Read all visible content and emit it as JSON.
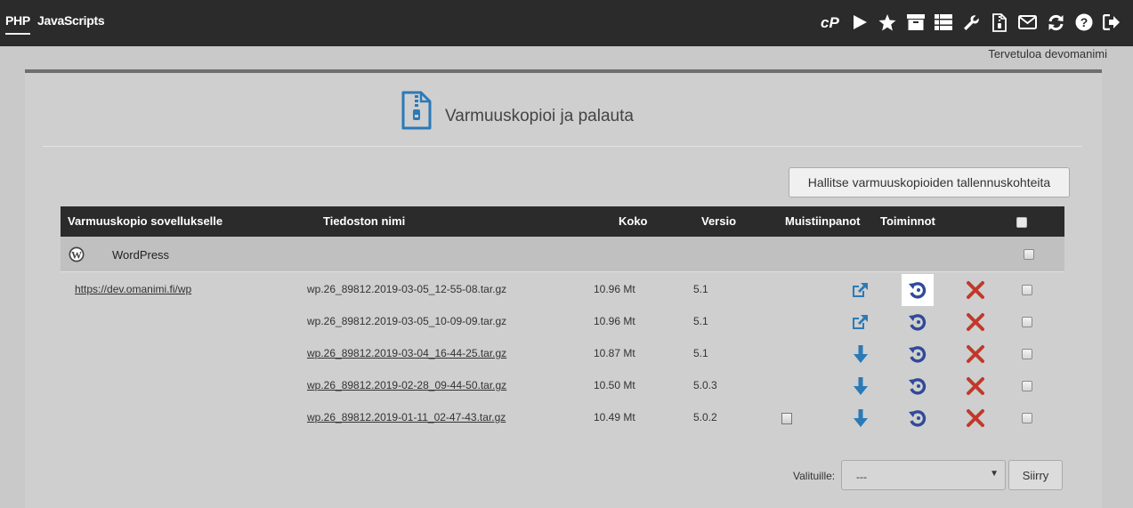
{
  "topbar": {
    "tabs": [
      "PHP",
      "JavaScripts"
    ],
    "icons": [
      "cpanel-icon",
      "play-icon",
      "star-icon",
      "archive-icon",
      "list-icon",
      "wrench-icon",
      "zip-file-icon",
      "mail-icon",
      "refresh-icon",
      "help-icon",
      "logout-icon"
    ]
  },
  "welcome": "Tervetuloa devomanimi",
  "page": {
    "title": "Varmuuskopioi ja palauta",
    "manage_button": "Hallitse varmuuskopioiden tallennuskohteita"
  },
  "table": {
    "headers": {
      "app": "Varmuuskopio sovellukselle",
      "filename": "Tiedoston nimi",
      "size": "Koko",
      "version": "Versio",
      "notes": "Muistiinpanot",
      "actions": "Toiminnot"
    },
    "group": {
      "name": "WordPress"
    },
    "url": "https://dev.omanimi.fi/wp",
    "rows": [
      {
        "filename": "wp.26_89812.2019-03-05_12-55-08.tar.gz",
        "size": "10.96 Mt",
        "version": "5.1",
        "action": "external-link"
      },
      {
        "filename": "wp.26_89812.2019-03-05_10-09-09.tar.gz",
        "size": "10.96 Mt",
        "version": "5.1",
        "action": "external-link"
      },
      {
        "filename": "wp.26_89812.2019-03-04_16-44-25.tar.gz",
        "size": "10.87 Mt",
        "version": "5.1",
        "action": "download"
      },
      {
        "filename": "wp.26_89812.2019-02-28_09-44-50.tar.gz",
        "size": "10.50 Mt",
        "version": "5.0.3",
        "action": "download"
      },
      {
        "filename": "wp.26_89812.2019-01-11_02-47-43.tar.gz",
        "size": "10.49 Mt",
        "version": "5.0.2",
        "action": "download",
        "has_note": true
      }
    ]
  },
  "footer": {
    "label": "Valituille:",
    "select_value": "---",
    "go_button": "Siirry"
  },
  "colors": {
    "topbar": "#2b2b2b",
    "action_blue": "#2a7ab8",
    "restore_blue": "#2f4a9a",
    "delete_red": "#c0392b"
  }
}
